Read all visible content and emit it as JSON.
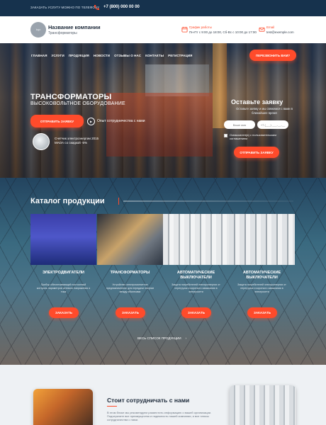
{
  "topbar": {
    "note": "ЗАКАЗАТЬ УСЛУГУ МОЖНО ПО ТЕЛЕФОНУ",
    "phone": "+7 (800) 000 00 00"
  },
  "header": {
    "logo_text": "logo",
    "company_name": "Название компании",
    "tagline": "Трансформаторы",
    "schedule_label": "График работы",
    "schedule_value": "Пн-Пт с 9:00 до 18:00, Сб-Вс с 10:00 до 17:00",
    "email_label": "Email",
    "email_value": "test@exemple.com"
  },
  "nav": {
    "items": [
      "ГЛАВНАЯ",
      "УСЛУГИ",
      "ПРОДУКЦИЯ",
      "НОВОСТИ",
      "ОТЗЫВЫ О НАС",
      "КОНТАКТЫ",
      "РЕГИСТРАЦИЯ"
    ],
    "callback_button": "ПЕРЕЗВОНИТЬ ВАМ?"
  },
  "hero": {
    "title": "ТРАНСФОРМАТОРЫ",
    "subtitle": "ВЫСОКОВОЛЬТНОЕ ОБОРУДОВАНИЕ",
    "order_button": "ОТПРАВИТЬ ЗАЯВКУ",
    "cooperation_link": "Опыт сотрудничества с нами",
    "promo_text": "Счетчик электроэнергии 2015 МАОА со скидкой -5%"
  },
  "request_form": {
    "title": "Оставьте заявку",
    "description": "Оставьте заявку и мы свяжемся с вами в ближайшее время",
    "name_placeholder": "Ваше имя",
    "phone_placeholder": "+7 (___) ___-__-__",
    "consent": "Ознакомлен(а) с пользовательским соглашением",
    "submit_button": "ОТПРАВИТЬ ЗАЯВКУ"
  },
  "catalog": {
    "title": "Каталог продукции",
    "cards": [
      {
        "title": "ЭЛЕКТРОДВИГАТЕЛИ",
        "description": "Прибор обеспечивающий постоянный контроль параметров сетевого напряжения и тока",
        "button": "ЗАКАЗАТЬ"
      },
      {
        "title": "ТРАНСФОРМАТОРЫ",
        "description": "Устройство электромагнитное предназначенное для передачи энергии между обмотками",
        "button": "ЗАКАЗАТЬ"
      },
      {
        "title": "АВТОМАТИЧЕСКИЕ ВЫКЛЮЧАТЕЛИ",
        "description": "Защита потребителей электроэнергии от перегрузок и короткого замыкания в электросети",
        "button": "ЗАКАЗАТЬ"
      },
      {
        "title": "АВТОМАТИЧЕСКИЕ ВЫКЛЮЧАТЕЛИ",
        "description": "Защита потребителей электроэнергии от перегрузок и короткого замыкания в электросети",
        "button": "ЗАКАЗАТЬ"
      }
    ],
    "all_products_link": "ВЕСЬ СПИСОК ПРОДУКЦИИ",
    "all_products_arrow": "›"
  },
  "why_us": {
    "title": "Стоит сотрудничать с нами",
    "text": "В этом блоке мы рекомендуем разместить информацию о вашей организации. Подчеркните все преимущества и надежность нашей компании, и все плюсы сотрудничества с нами."
  },
  "colors": {
    "accent": "#ff4b2b",
    "topbar": "#16324d",
    "section_bg": "#eef1f4"
  }
}
